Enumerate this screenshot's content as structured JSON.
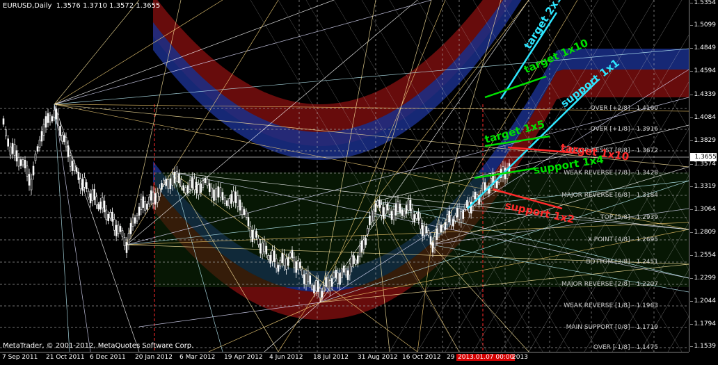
{
  "chart": {
    "title": "EURUSD,Daily  1.3576 1.3710 1.3572 1.3655",
    "copyright": "MetaTrader, © 2001-2012, MetaQuotes Software Corp."
  },
  "price_axis": {
    "ticks": [
      "1.5354",
      "1.5099",
      "1.4849",
      "1.4594",
      "1.4339",
      "1.4084",
      "1.3829",
      "1.3574",
      "1.3319",
      "1.3064",
      "1.2809",
      "1.2554",
      "1.2299",
      "1.2044",
      "1.1794",
      "1.1539"
    ],
    "current_price": "1.3655"
  },
  "date_axis": {
    "ticks": [
      "7 Sep 2011",
      "21 Oct 2011",
      "6 Dec 2011",
      "20 Jan 2012",
      "6 Mar 2012",
      "19 Apr 2012",
      "4 Jun 2012",
      "18 Jul 2012",
      "31 Aug 2012",
      "16 Oct 2012",
      "29",
      "2013.01.07 00:00",
      "2013"
    ]
  },
  "murrey_levels": [
    {
      "label": "OVER  [+2/8] - 1.4160"
    },
    {
      "label": "OVER  [+1/8] - 1.3916"
    },
    {
      "label": "MAJOR RESIST  [8/8] - 1.3672"
    },
    {
      "label": "WEAK REVERSE  [7/8] - 1.3428"
    },
    {
      "label": "MAJOR REVERSE  [6/8] - 1.3184"
    },
    {
      "label": "TOP  [5/8] - 1.2939"
    },
    {
      "label": "X POINT  [4/8] - 1.2695"
    },
    {
      "label": "BOTTOM  [3/8] - 1.2451"
    },
    {
      "label": "MAJOR REVERSE  [2/8] - 1.2207"
    },
    {
      "label": "WEAK REVERSE  [1/8] - 1.1963"
    },
    {
      "label": "MAIN SUPPORT  [0/8] - 1.1719"
    },
    {
      "label": "OVER  [-1/8] - 1.1475"
    }
  ],
  "annotations": {
    "target_2x1": "target 2x1",
    "target_1x10_green": "target 1x10",
    "support_1x1": "support 1x1",
    "target_1x5": "target 1x5",
    "target_1x10_red": "target 1x10",
    "support_1x4": "support 1x4",
    "support_1x2": "support 1x2"
  },
  "colors": {
    "background": "#000000",
    "candles": "#ffffff",
    "target": "#00e000",
    "support_cyan": "#2ee6ff",
    "red": "#ff2a2a",
    "arc_red": "#8a1010",
    "arc_blue": "#1a2f8a"
  }
}
